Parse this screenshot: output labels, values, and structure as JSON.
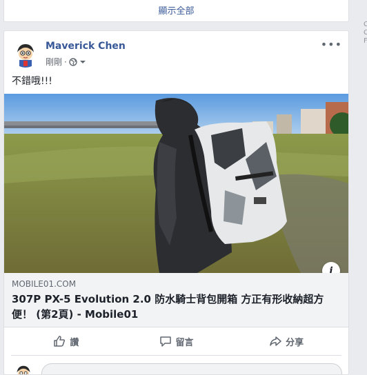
{
  "top_card": {
    "show_all": "顯示全部"
  },
  "post": {
    "author": "Maverick Chen",
    "time": "剛剛",
    "text": "不錯哦!!!",
    "link": {
      "domain": "MOBILE01.COM",
      "title": "307P PX-5 Evolution 2.0 防水騎士背包開箱 方正有形收納超方便！ (第2頁) - Mobile01"
    },
    "actions": [
      {
        "label": "讚",
        "icon": "thumbs-up-icon"
      },
      {
        "label": "留言",
        "icon": "comment-icon"
      },
      {
        "label": "分享",
        "icon": "share-icon"
      }
    ]
  },
  "colors": {
    "link_blue": "#385898",
    "text_gray": "#606770",
    "page_bg": "#e9ebee"
  }
}
